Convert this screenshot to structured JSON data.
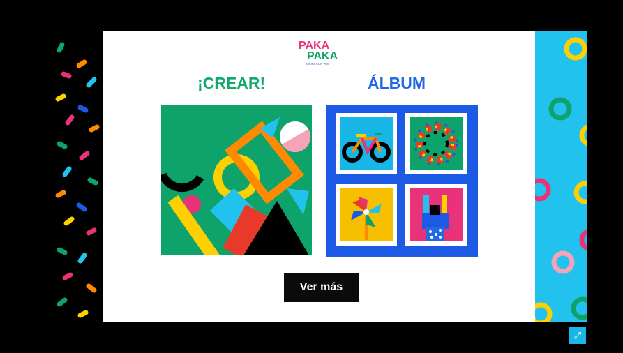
{
  "logo": {
    "line1": "PAKA",
    "line2": "PAKA",
    "subtitle": "AHORA CON VOS"
  },
  "sections": {
    "crear": {
      "title": "¡CREAR!"
    },
    "album": {
      "title": "ÁLBUM"
    }
  },
  "actions": {
    "ver_mas_label": "Ver más",
    "fullscreen_icon": "expand-icon"
  },
  "colors": {
    "background": "#000000",
    "panel": "#ffffff",
    "crear_title": "#10a86b",
    "album_title": "#2369e6",
    "crear_card": "#0ea36b",
    "album_card": "#1c5ae6",
    "right_strip": "#21c3ee",
    "button": "#0b0b0b",
    "fullscreen_button": "#1ab7e6"
  },
  "album_thumbnails": [
    {
      "icon": "bicycle-icon",
      "bg": "#18b6e6"
    },
    {
      "icon": "ring-of-figures-icon",
      "bg": "#0ea36b"
    },
    {
      "icon": "pinwheel-icon",
      "bg": "#f6c000"
    },
    {
      "icon": "hand-gesture-icon",
      "bg": "#e8337a"
    }
  ]
}
